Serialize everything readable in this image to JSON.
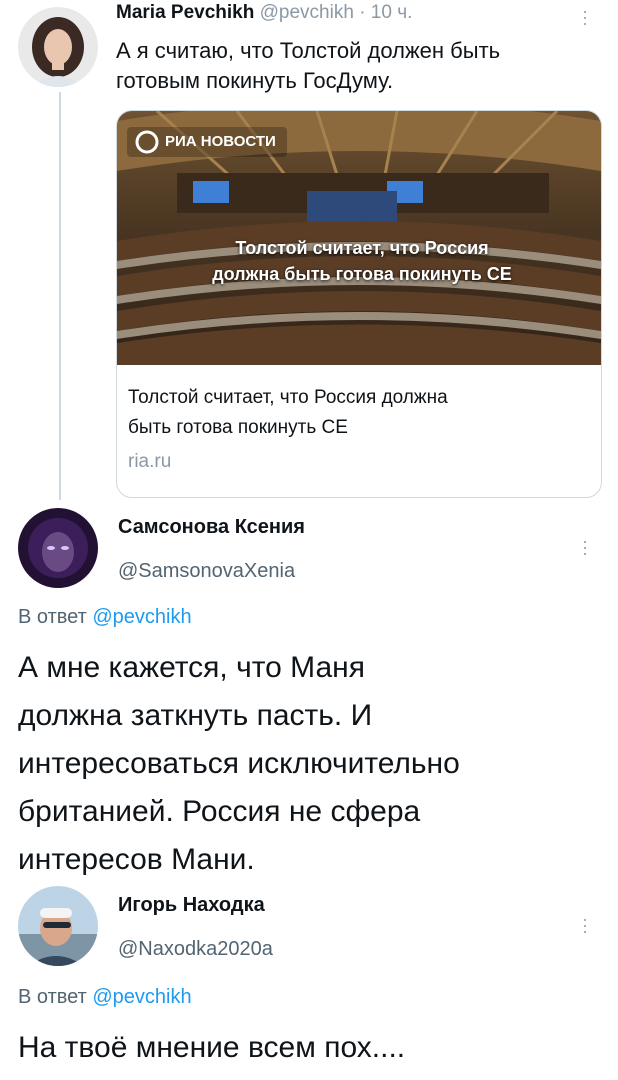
{
  "tweet1": {
    "author_name": "Maria Pevchikh",
    "author_handle": "@pevchikh",
    "time": "· 10 ч.",
    "text_line1": "А я считаю, что Толстой должен быть",
    "text_line2": "готовым покинуть ГосДуму.",
    "card": {
      "image_logo": "РИА НОВОСТИ",
      "image_caption_line1": "Толстой считает, что Россия",
      "image_caption_line2": "должна быть готова покинуть СЕ",
      "title_line1": "Толстой считает, что Россия должна",
      "title_line2": "быть готова покинуть СЕ",
      "domain": "ria.ru"
    }
  },
  "reply1": {
    "author_name": "Самсонова Ксения",
    "author_handle": "@SamsonovaXenia",
    "replying_prefix": "В ответ ",
    "replying_to": "@pevchikh",
    "lines": [
      "А мне кажется, что Маня",
      "должна заткнуть пасть. И",
      "интересоваться исключительно",
      "британией. Россия не сфера",
      "интересов Мани."
    ]
  },
  "reply2": {
    "author_name": "Игорь Находка",
    "author_handle": "@Naxodka2020a",
    "replying_prefix": "В ответ ",
    "replying_to": "@pevchikh",
    "lines": [
      "На твоё мнение всем пох...."
    ]
  },
  "colors": {
    "link": "#1d9bf0",
    "muted": "#8b98a5",
    "text": "#0f1419",
    "thread_line": "#cfd9de"
  }
}
